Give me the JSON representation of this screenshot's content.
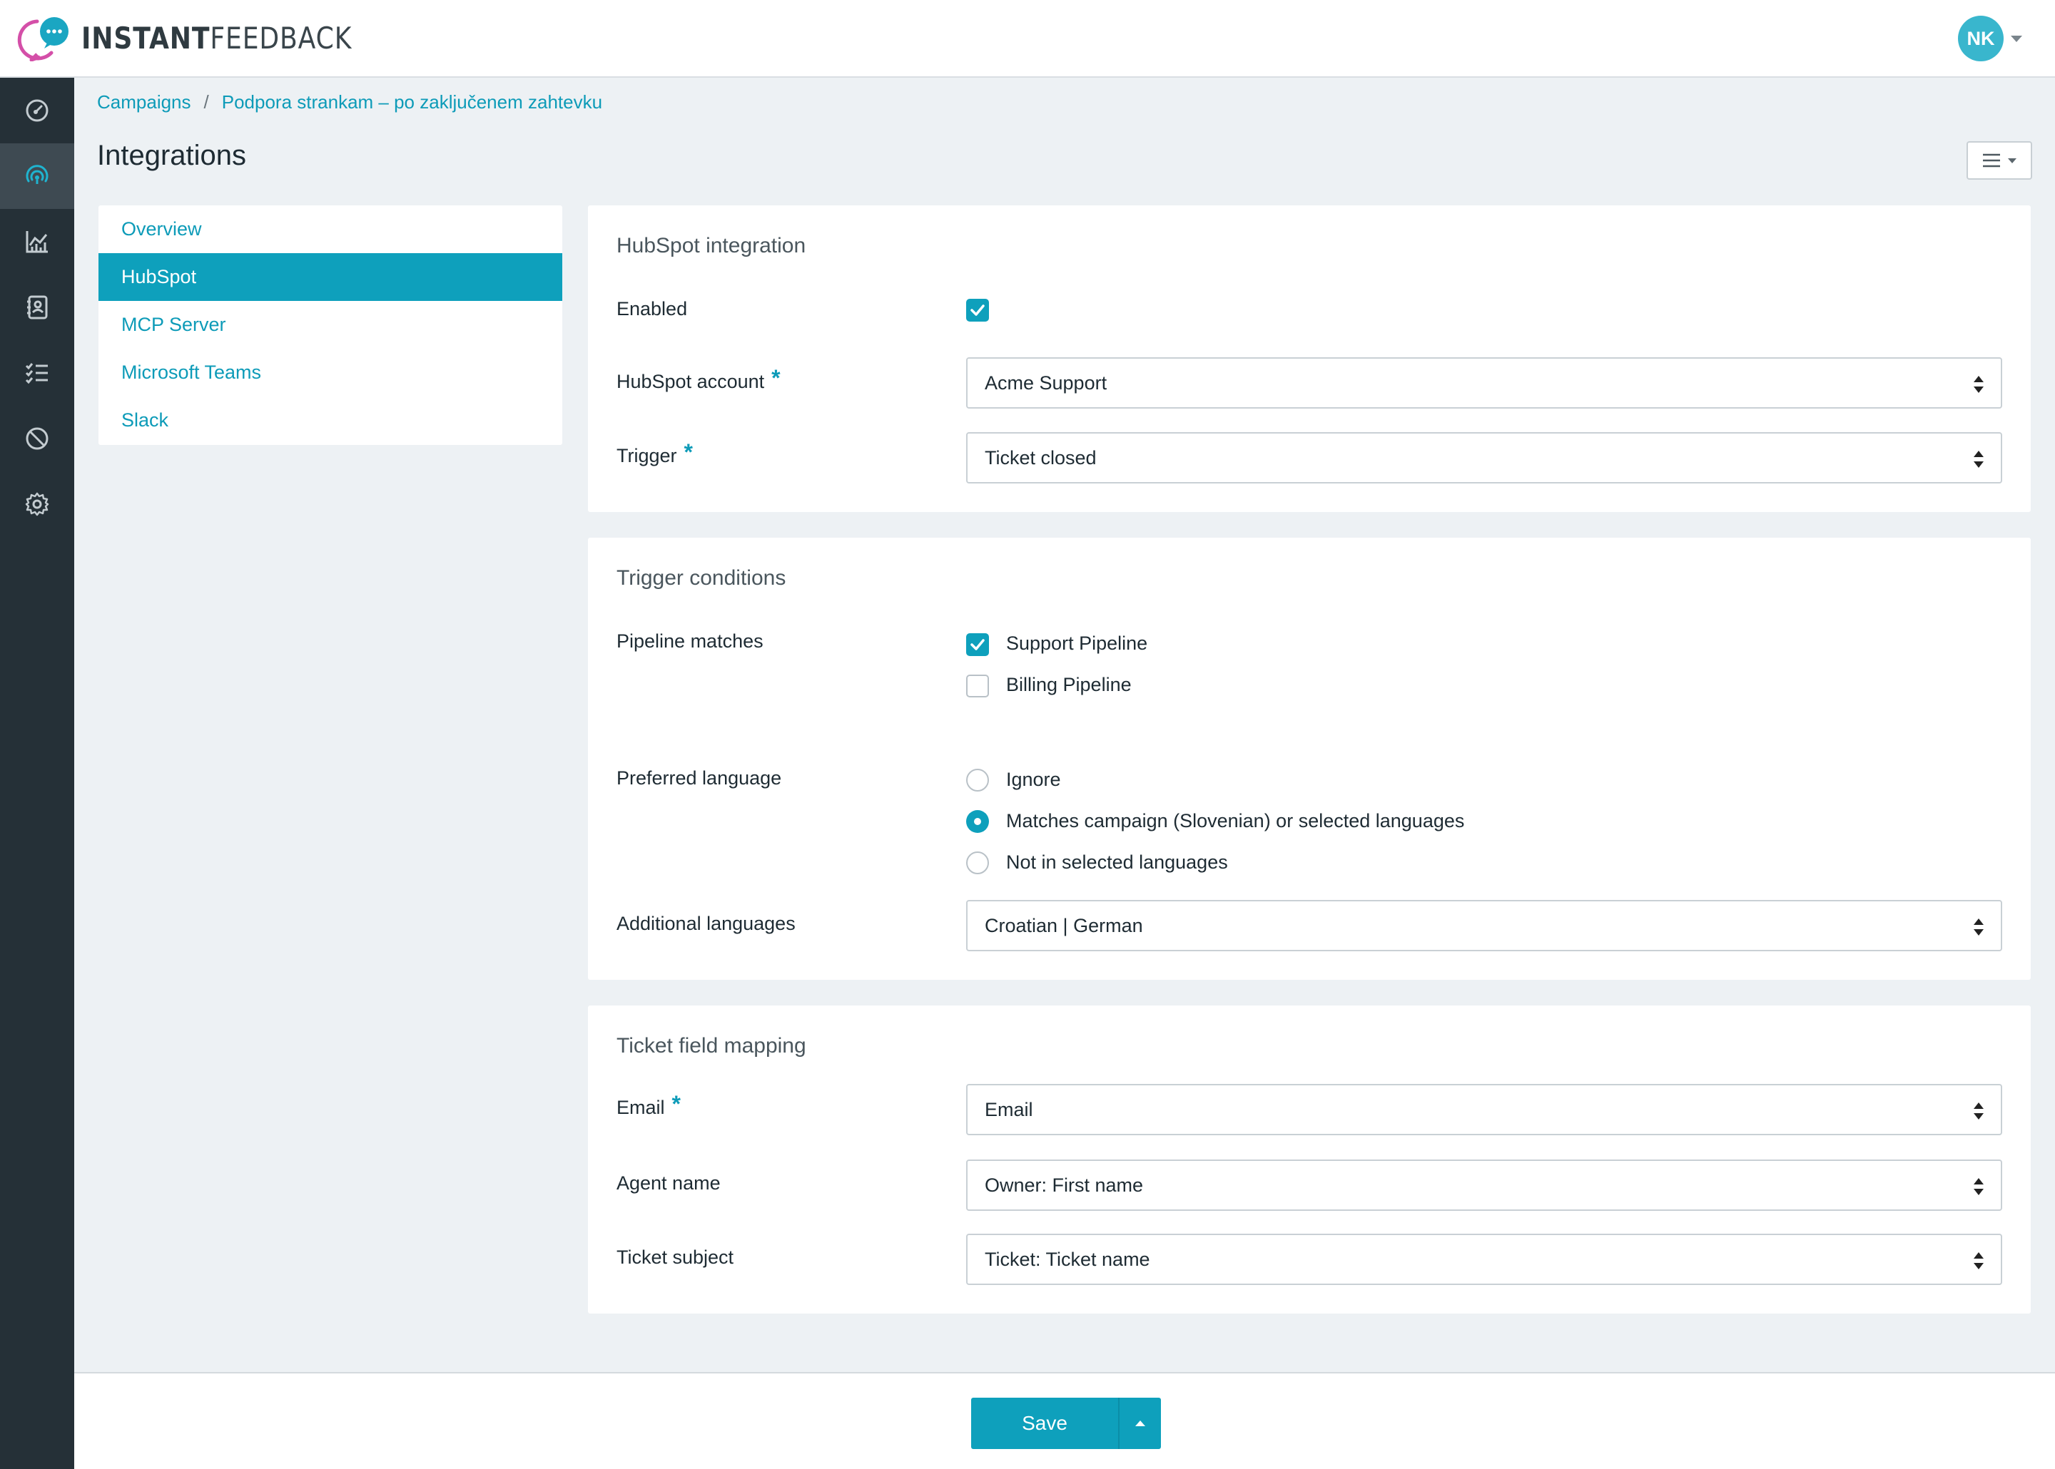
{
  "app": {
    "brand_bold": "INSTANT",
    "brand_light": "FEEDBACK",
    "user_initials": "NK"
  },
  "sidebar": {
    "items": [
      {
        "icon": "dashboard-icon",
        "active": false
      },
      {
        "icon": "broadcast-icon",
        "active": true
      },
      {
        "icon": "analytics-icon",
        "active": false
      },
      {
        "icon": "contacts-icon",
        "active": false
      },
      {
        "icon": "checklist-icon",
        "active": false
      },
      {
        "icon": "block-icon",
        "active": false
      },
      {
        "icon": "gear-icon",
        "active": false
      }
    ]
  },
  "breadcrumb": {
    "root": "Campaigns",
    "separator": "/",
    "current": "Podpora strankam – po zaključenem zahtevku"
  },
  "page": {
    "title": "Integrations"
  },
  "subnav": {
    "items": [
      "Overview",
      "HubSpot",
      "MCP Server",
      "Microsoft Teams",
      "Slack"
    ],
    "active": "HubSpot"
  },
  "hubspot": {
    "title": "HubSpot integration",
    "enabled_label": "Enabled",
    "enabled": true,
    "account_label": "HubSpot account",
    "account_value": "Acme Support",
    "trigger_label": "Trigger",
    "trigger_value": "Ticket closed"
  },
  "conditions": {
    "title": "Trigger conditions",
    "pipeline_label": "Pipeline matches",
    "pipelines": [
      {
        "label": "Support Pipeline",
        "checked": true
      },
      {
        "label": "Billing Pipeline",
        "checked": false
      }
    ],
    "language_label": "Preferred language",
    "language_options": [
      {
        "label": "Ignore",
        "selected": false
      },
      {
        "label": "Matches campaign (Slovenian) or selected languages",
        "selected": true
      },
      {
        "label": "Not in selected languages",
        "selected": false
      }
    ],
    "additional_label": "Additional languages",
    "additional_value": "Croatian | German"
  },
  "mapping": {
    "title": "Ticket field mapping",
    "email_label": "Email",
    "email_value": "Email",
    "agent_label": "Agent name",
    "agent_value": "Owner: First name",
    "subject_label": "Ticket subject",
    "subject_value": "Ticket: Ticket name"
  },
  "required_marker": "*",
  "footer": {
    "save_label": "Save"
  },
  "colors": {
    "accent": "#0ea0bc",
    "sidebar_bg": "#253037",
    "sidebar_active": "#3e4a52",
    "page_bg": "#edf1f4",
    "avatar": "#39b6cd"
  }
}
